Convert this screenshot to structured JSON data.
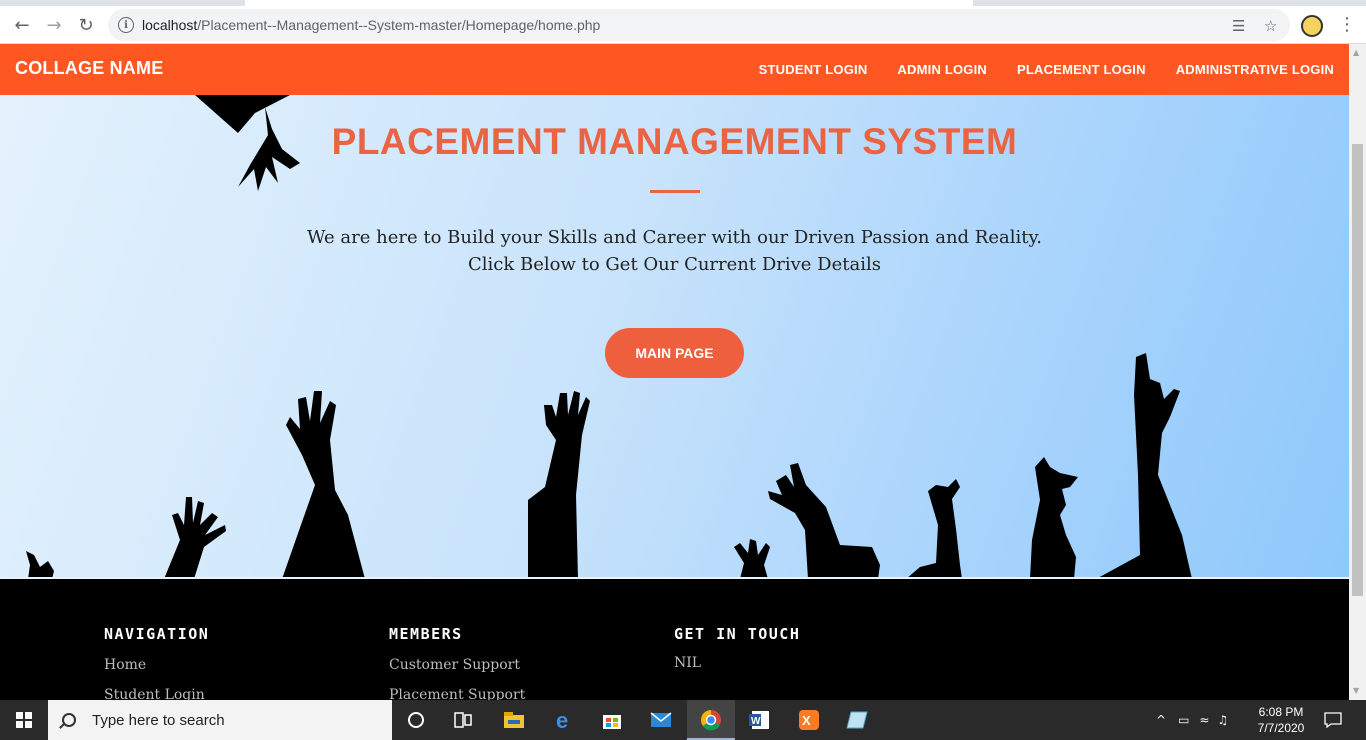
{
  "browser": {
    "url_host": "localhost",
    "url_path": "/Placement--Management--System-master/Homepage/home.php"
  },
  "site": {
    "brand": "COLLAGE NAME",
    "nav": [
      "STUDENT LOGIN",
      "ADMIN LOGIN",
      "PLACEMENT LOGIN",
      "ADMINISTRATIVE LOGIN"
    ],
    "hero": {
      "title": "PLACEMENT MANAGEMENT SYSTEM",
      "line1": "We are here to Build your Skills and Career with our Driven Passion and Reality.",
      "line2": "Click Below to Get Our Current Drive Details",
      "button": "MAIN PAGE"
    },
    "footer": {
      "navigation": {
        "heading": "NAVIGATION",
        "links": [
          "Home",
          "Student Login"
        ]
      },
      "members": {
        "heading": "MEMBERS",
        "links": [
          "Customer Support",
          "Placement Support"
        ]
      },
      "contact": {
        "heading": "GET IN TOUCH",
        "text": "NIL"
      }
    }
  },
  "taskbar": {
    "search_placeholder": "Type here to search",
    "time": "6:08 PM",
    "date": "7/7/2020"
  },
  "colors": {
    "nav_bg": "#fe5722",
    "accent": "#ea6444",
    "footer_bg": "#000000"
  }
}
